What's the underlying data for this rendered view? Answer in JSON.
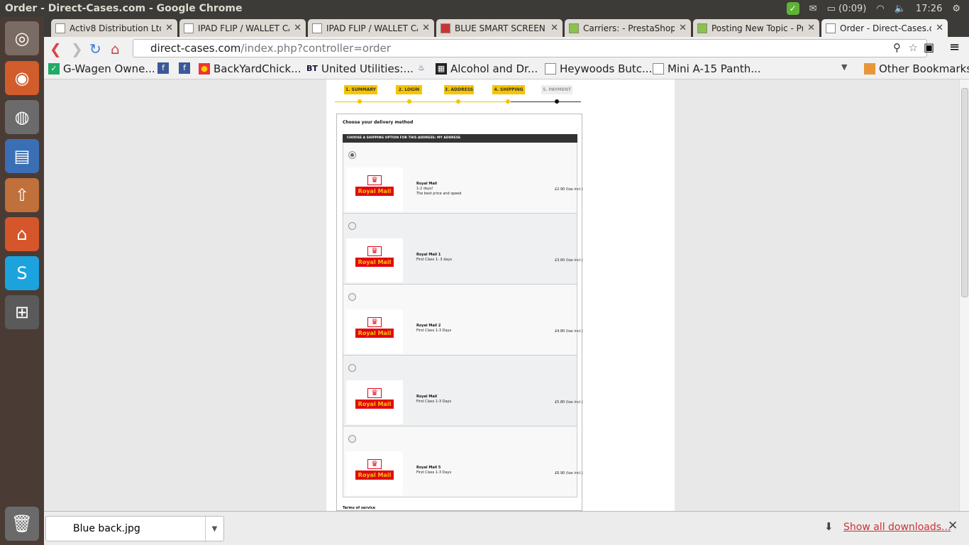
{
  "window": {
    "title": "Order - Direct-Cases.com - Google Chrome"
  },
  "indicators": {
    "battery": "(0:09)",
    "clock": "17:26"
  },
  "tabs": [
    {
      "label": "Activ8 Distribution Ltd"
    },
    {
      "label": "IPAD FLIP / WALLET CA"
    },
    {
      "label": "IPAD FLIP / WALLET CA"
    },
    {
      "label": "BLUE SMART SCREEN C"
    },
    {
      "label": "Carriers: - PrestaShop™"
    },
    {
      "label": "Posting New Topic - Pre"
    },
    {
      "label": "Order - Direct-Cases.co"
    }
  ],
  "address": {
    "host": "direct-cases.com",
    "path": "/index.php?controller=order"
  },
  "bookmarks": [
    {
      "label": "G-Wagen Owne..."
    },
    {
      "label": ""
    },
    {
      "label": ""
    },
    {
      "label": "BackYardChick..."
    },
    {
      "label": "United Utilities:..."
    },
    {
      "label": ""
    },
    {
      "label": "Alcohol and Dr..."
    },
    {
      "label": "Heywoods Butc..."
    },
    {
      "label": "Mini A-15 Panth..."
    }
  ],
  "other_bookmarks": "Other Bookmarks",
  "steps": [
    "1. SUMMARY",
    "2. LOGIN",
    "3. ADDRESS",
    "4. SHIPPING",
    "5. PAYMENT"
  ],
  "shipping": {
    "title": "Choose your delivery method",
    "header": "CHOOSE A SHIPPING OPTION FOR THIS ADDRESS: MY ADDRESS",
    "logo_text": "Royal Mail",
    "options": [
      {
        "name": "Royal Mail",
        "desc1": "1-2 days!",
        "desc2": "The best price and speed",
        "price": "£2.90 (tax incl.)"
      },
      {
        "name": "Royal Mail 1",
        "desc1": "First Class 1- 3 days",
        "desc2": "",
        "price": "£3.60 (tax incl.)"
      },
      {
        "name": "Royal Mail 2",
        "desc1": "First Class 1-3 Days",
        "desc2": "",
        "price": "£4.80 (tax incl.)"
      },
      {
        "name": "Royal Mail",
        "desc1": "First Class 1-3 Days",
        "desc2": "",
        "price": "£5.80 (tax incl.)"
      },
      {
        "name": "Royal Mail 5",
        "desc1": "First Class 1-3 Days",
        "desc2": "",
        "price": "£6.90 (tax incl.)"
      }
    ],
    "terms": "Terms of service"
  },
  "downloads": {
    "item": "Blue back.jpg",
    "show_all": "Show all downloads..."
  }
}
